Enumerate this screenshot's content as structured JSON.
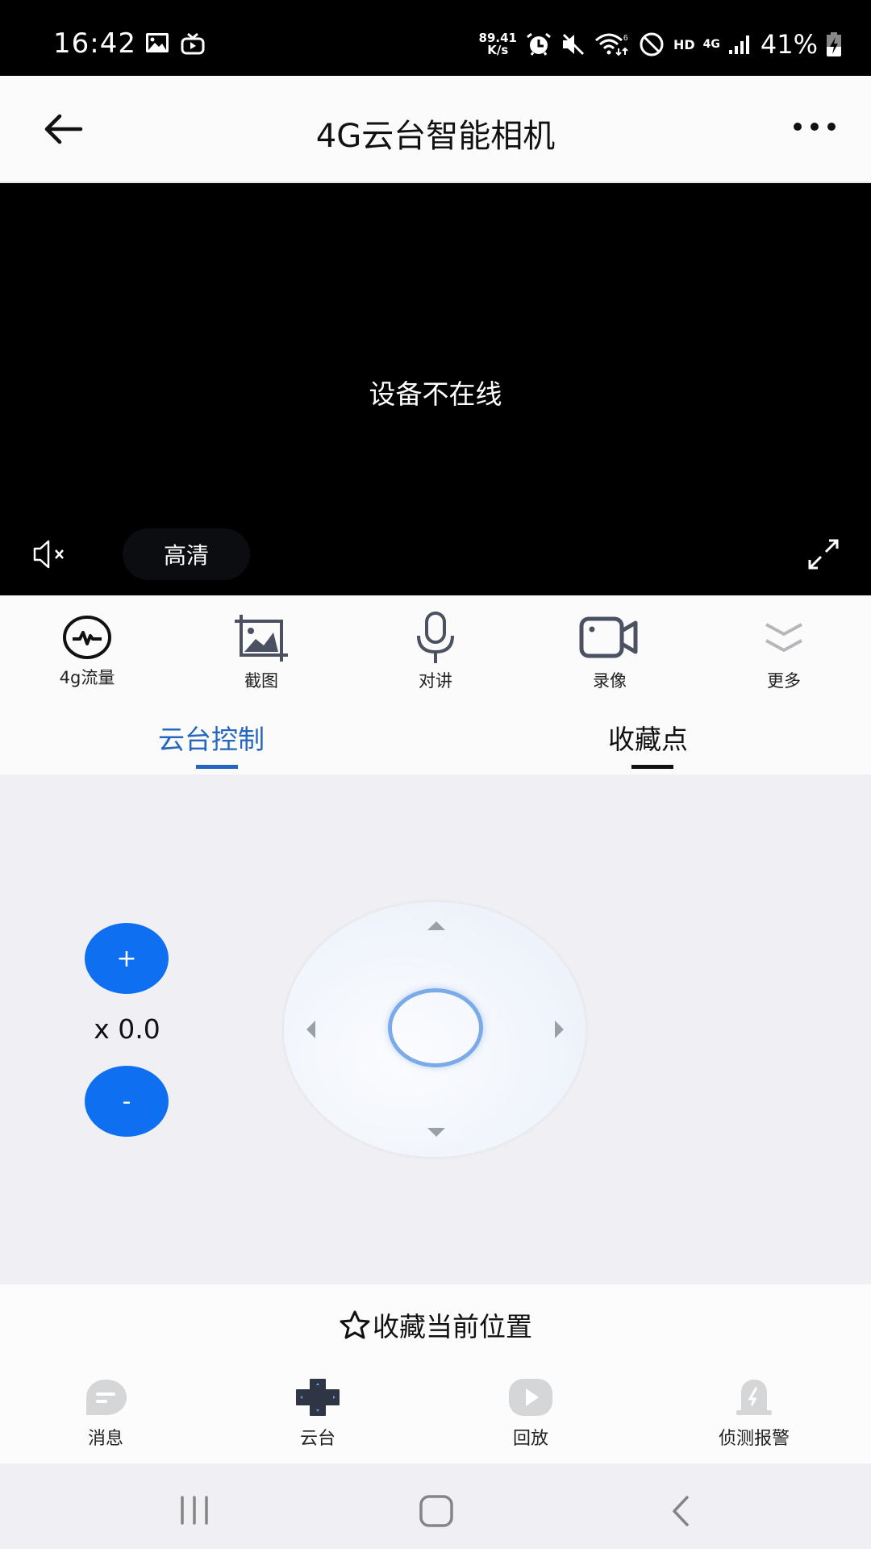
{
  "status_bar": {
    "time": "16:42",
    "net_speed_value": "89.41",
    "net_speed_unit": "K/s",
    "wifi_badge": "6",
    "hd_label": "HD",
    "network_type": "4G",
    "battery_percent": "41%",
    "icons": [
      "gallery-icon",
      "tv-icon",
      "alarm-icon",
      "mute-icon",
      "wifi-icon",
      "do-not-disturb-icon",
      "signal-icon",
      "battery-charging-icon"
    ]
  },
  "header": {
    "title": "4G云台智能相机"
  },
  "video": {
    "status_text": "设备不在线",
    "quality_label": "高清"
  },
  "toolbar": {
    "items": [
      {
        "label": "4g流量",
        "icon": "data-traffic-icon"
      },
      {
        "label": "截图",
        "icon": "screenshot-icon"
      },
      {
        "label": "对讲",
        "icon": "microphone-icon"
      },
      {
        "label": "录像",
        "icon": "video-record-icon"
      },
      {
        "label": "更多",
        "icon": "double-chevron-down-icon"
      }
    ]
  },
  "tabs": [
    {
      "label": "云台控制",
      "active": true,
      "color": "#2566c0"
    },
    {
      "label": "收藏点",
      "active": false,
      "color": "#111111"
    }
  ],
  "ptz": {
    "zoom_in_label": "+",
    "zoom_out_label": "-",
    "zoom_value": "x 0.0",
    "accent": "#0e6ff0"
  },
  "favorite": {
    "button_label": "收藏当前位置"
  },
  "bottom_nav": {
    "items": [
      {
        "label": "消息",
        "icon": "message-icon",
        "active": false
      },
      {
        "label": "云台",
        "icon": "dpad-icon",
        "active": true
      },
      {
        "label": "回放",
        "icon": "playback-icon",
        "active": false
      },
      {
        "label": "侦测报警",
        "icon": "alarm-siren-icon",
        "active": false
      }
    ]
  }
}
